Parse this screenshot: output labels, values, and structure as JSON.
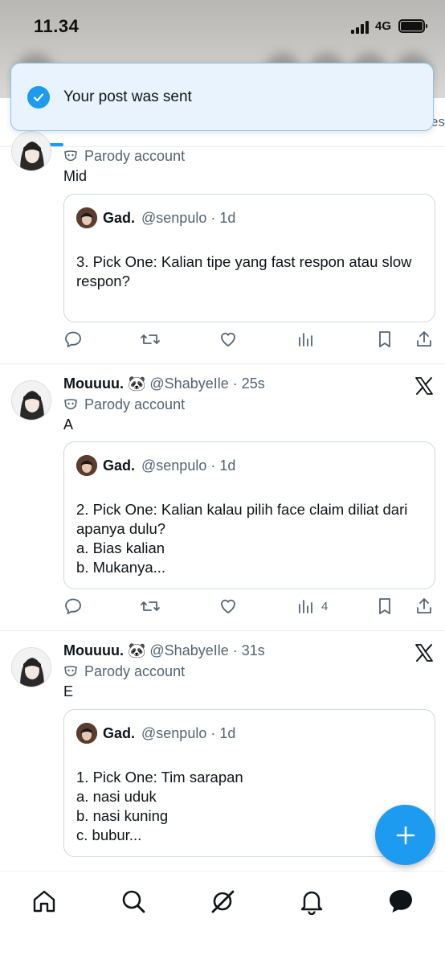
{
  "status_bar": {
    "time": "11.34",
    "network": "4G"
  },
  "toast": {
    "message": "Your post was sent"
  },
  "tabs_tail_text": "es",
  "posts": [
    {
      "name": "",
      "handle": "",
      "time": "",
      "parody_label": "Parody account",
      "text": "Mid",
      "quote": {
        "name": "Gad.",
        "handle": "@senpulo",
        "time": "1d",
        "body": "3. Pick One: Kalian tipe yang fast respon atau slow respon?"
      },
      "views": ""
    },
    {
      "name": "Mouuuu. 🐼",
      "handle": "@ShabyeIle",
      "time": "25s",
      "parody_label": "Parody account",
      "text": "A",
      "quote": {
        "name": "Gad.",
        "handle": "@senpulo",
        "time": "1d",
        "body": "2. Pick One: Kalian kalau pilih face claim diliat dari apanya dulu?\na. Bias kalian\nb. Mukanya..."
      },
      "views": "4"
    },
    {
      "name": "Mouuuu. 🐼",
      "handle": "@ShabyeIle",
      "time": "31s",
      "parody_label": "Parody account",
      "text": "E",
      "quote": {
        "name": "Gad.",
        "handle": "@senpulo",
        "time": "1d",
        "body": "1. Pick One: Tim sarapan\na. nasi uduk\nb. nasi kuning\nc. bubur..."
      },
      "views": ""
    }
  ],
  "nav": [
    "home-icon",
    "search-icon",
    "grok-icon",
    "notifications-icon",
    "messages-icon"
  ],
  "colors": {
    "accent": "#1d9bf0",
    "muted": "#536471",
    "text": "#0f1419"
  }
}
